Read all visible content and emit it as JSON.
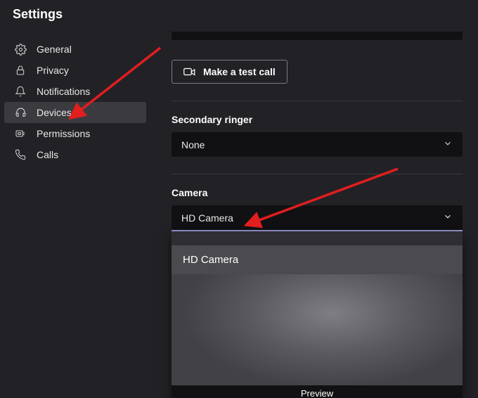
{
  "window": {
    "title": "Settings"
  },
  "sidebar": {
    "items": [
      {
        "label": "General",
        "icon": "gear-icon"
      },
      {
        "label": "Privacy",
        "icon": "lock-icon"
      },
      {
        "label": "Notifications",
        "icon": "bell-icon"
      },
      {
        "label": "Devices",
        "icon": "headset-icon",
        "active": true
      },
      {
        "label": "Permissions",
        "icon": "key-icon"
      },
      {
        "label": "Calls",
        "icon": "phone-icon"
      }
    ]
  },
  "main": {
    "test_call_label": "Make a test call",
    "secondary_ringer": {
      "label": "Secondary ringer",
      "value": "None"
    },
    "camera": {
      "label": "Camera",
      "value": "HD Camera",
      "options": [
        "HD Camera"
      ],
      "preview_label": "Preview"
    }
  },
  "annotations": [
    {
      "type": "arrow",
      "from": "top-left",
      "to": "sidebar-devices",
      "color": "#e21e1e"
    },
    {
      "type": "arrow",
      "from": "upper-right",
      "to": "camera-select",
      "color": "#e21e1e"
    }
  ]
}
